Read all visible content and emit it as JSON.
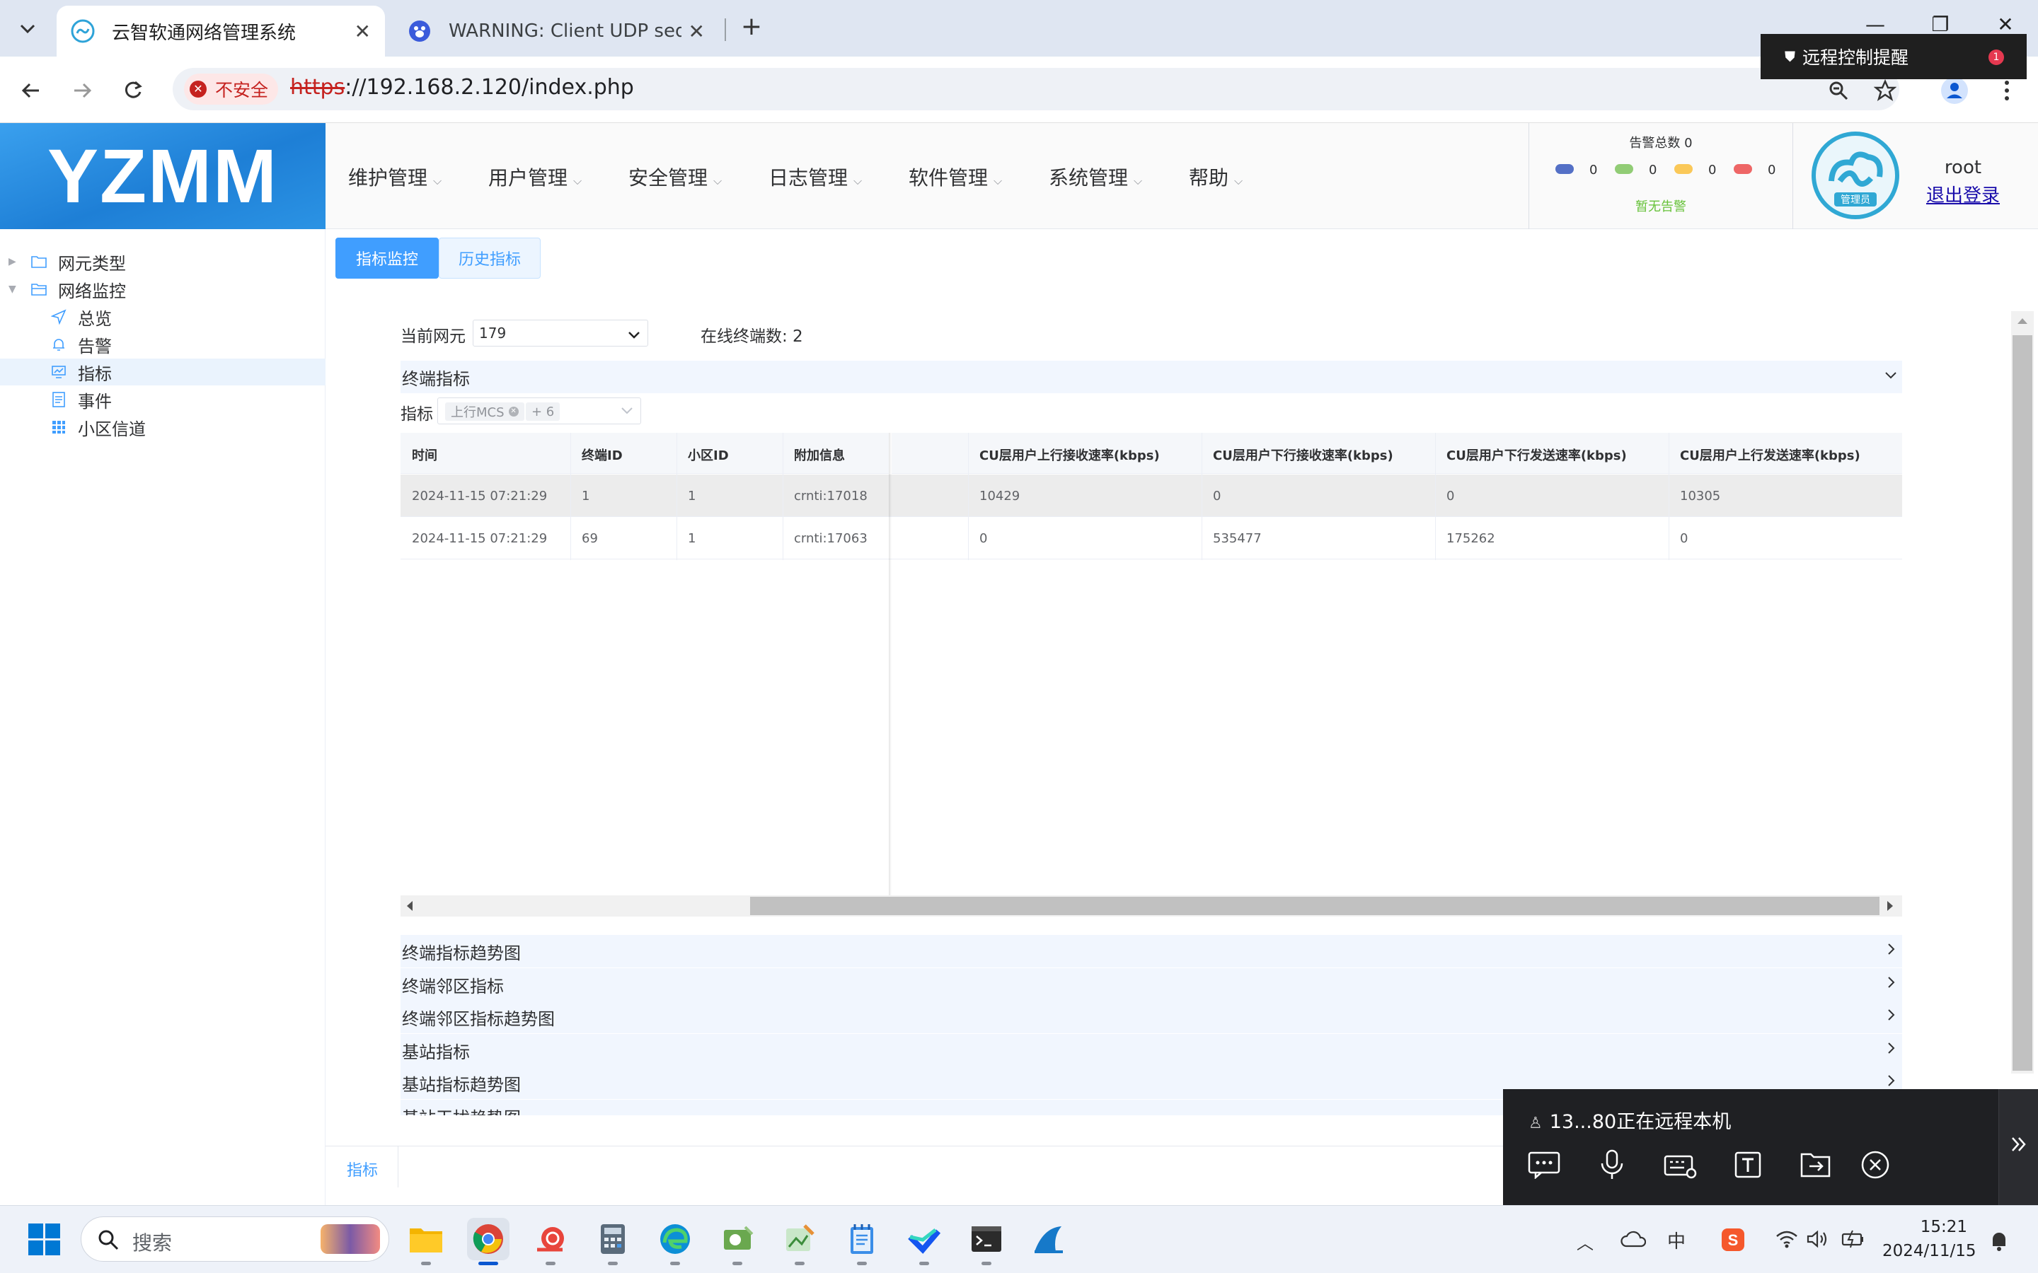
{
  "browser": {
    "tabs": [
      {
        "title": "云智软通网络管理系统",
        "active": true
      },
      {
        "title": "WARNING: Client UDP seque",
        "active": false
      }
    ],
    "security_label": "不安全",
    "url_scheme": "https",
    "url_rest": "://192.168.2.120/index.php",
    "remote_notice": "远程控制提醒",
    "remote_notice_badge": "1"
  },
  "app": {
    "logo": "YZMM",
    "menu": [
      "维护管理",
      "用户管理",
      "安全管理",
      "日志管理",
      "软件管理",
      "系统管理",
      "帮助"
    ],
    "alarm": {
      "title": "告警总数 0",
      "counts": [
        {
          "color": "#5470c6",
          "value": "0"
        },
        {
          "color": "#91cc75",
          "value": "0"
        },
        {
          "color": "#fac858",
          "value": "0"
        },
        {
          "color": "#ee6666",
          "value": "0"
        }
      ],
      "status": "暂无告警"
    },
    "avatar_label": "管理员",
    "user": "root",
    "logout": "退出登录"
  },
  "sidebar": {
    "groups": [
      {
        "label": "网元类型",
        "icon": "folder-icon"
      },
      {
        "label": "网络监控",
        "icon": "folder-open-icon"
      }
    ],
    "items": [
      {
        "label": "总览",
        "icon": "send-icon"
      },
      {
        "label": "告警",
        "icon": "bell-icon"
      },
      {
        "label": "指标",
        "icon": "monitor-icon",
        "selected": true
      },
      {
        "label": "事件",
        "icon": "document-icon"
      },
      {
        "label": "小区信道",
        "icon": "grid-icon"
      }
    ]
  },
  "main": {
    "subtabs": [
      "指标监控",
      "历史指标"
    ],
    "current_ne_label": "当前网元",
    "current_ne_value": "179",
    "online_label": "在线终端数: 2",
    "terminal_section": "终端指标",
    "metric_label": "指标",
    "metric_tag": "上行MCS",
    "metric_more": "+ 6",
    "table": {
      "columns": [
        "时间",
        "终端ID",
        "小区ID",
        "附加信息",
        "CU层用户上行接收速率(kbps)",
        "CU层用户下行接收速率(kbps)",
        "CU层用户下行发送速率(kbps)",
        "CU层用户上行发送速率(kbps)"
      ],
      "rows": [
        [
          "2024-11-15 07:21:29",
          "1",
          "1",
          "crnti:17018",
          "10429",
          "0",
          "0",
          "10305"
        ],
        [
          "2024-11-15 07:21:29",
          "69",
          "1",
          "crnti:17063",
          "0",
          "535477",
          "175262",
          "0"
        ]
      ]
    },
    "collapsed_sections": [
      "终端指标趋势图",
      "终端邻区指标",
      "终端邻区指标趋势图",
      "基站指标",
      "基站指标趋势图",
      "基站干扰趋势图"
    ],
    "bottom_tab": "指标"
  },
  "remote_panel": {
    "text": "13...80正在远程本机",
    "tools": [
      "chat-icon",
      "microphone-icon",
      "keyboard-icon",
      "text-icon",
      "file-transfer-icon",
      "close-circle-icon"
    ]
  },
  "taskbar": {
    "search_placeholder": "搜索",
    "ime": "中",
    "time": "15:21",
    "date": "2024/11/15"
  }
}
